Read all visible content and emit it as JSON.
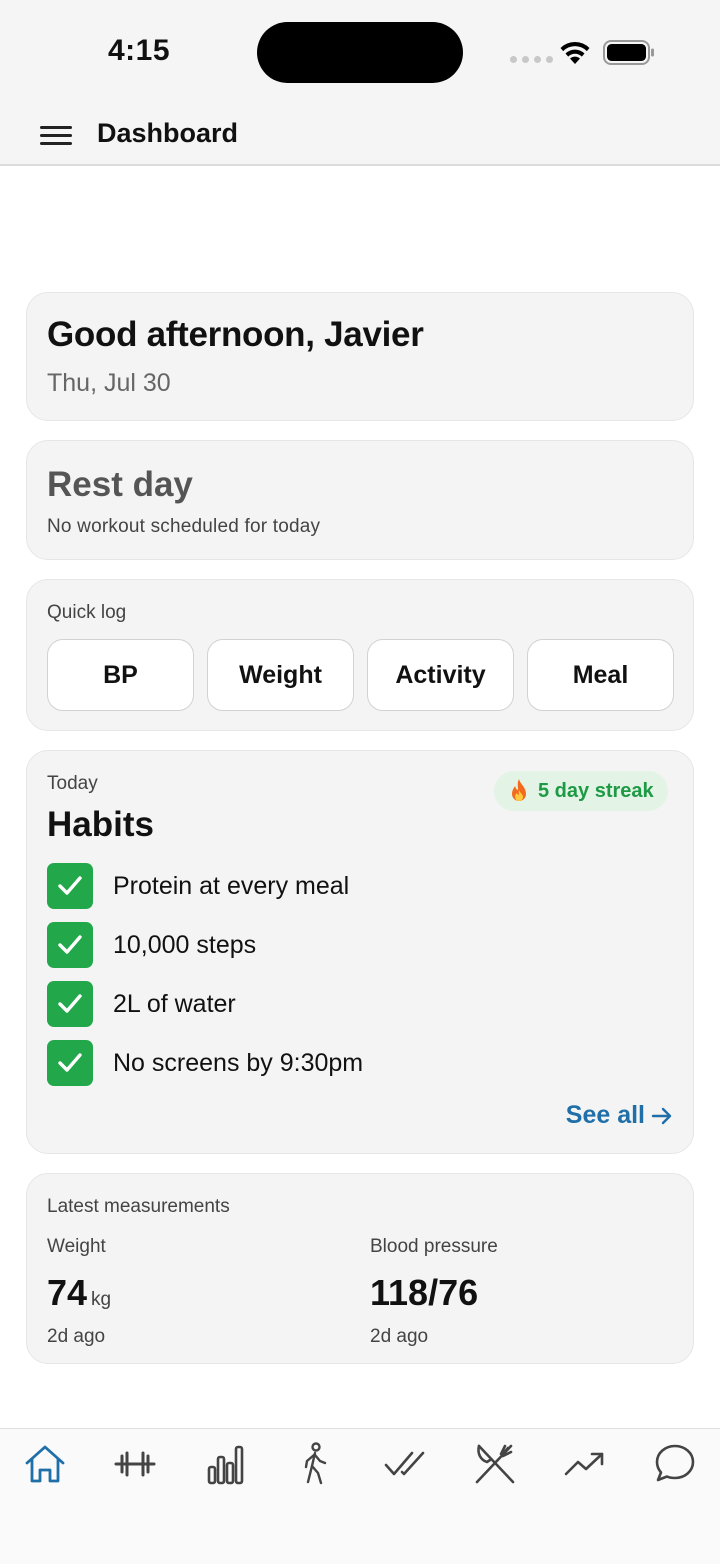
{
  "status_bar": {
    "time": "4:15"
  },
  "header": {
    "title": "Dashboard"
  },
  "greeting": {
    "title": "Good afternoon, Javier",
    "date": "Thu, Jul 30"
  },
  "workout": {
    "title": "Rest day",
    "subtitle": "No workout scheduled for today"
  },
  "quick_log": {
    "label": "Quick log",
    "buttons": [
      {
        "label": "BP"
      },
      {
        "label": "Weight"
      },
      {
        "label": "Activity"
      },
      {
        "label": "Meal"
      }
    ]
  },
  "habits": {
    "eyebrow": "Today",
    "title": "Habits",
    "streak": "5 day streak",
    "items": [
      {
        "label": "Protein at every meal",
        "done": true
      },
      {
        "label": "10,000 steps",
        "done": true
      },
      {
        "label": "2L of water",
        "done": true
      },
      {
        "label": "No screens by 9:30pm",
        "done": true
      }
    ],
    "see_all": "See all"
  },
  "measurements": {
    "label": "Latest measurements",
    "weight": {
      "name": "Weight",
      "value": "74",
      "unit": "kg",
      "ago": "2d ago"
    },
    "blood_pressure": {
      "name": "Blood pressure",
      "value": "118/76",
      "ago": "2d ago"
    }
  },
  "tab_bar": {
    "active_color": "#1f6fa8",
    "inactive_color": "#555555",
    "tabs": [
      {
        "icon": "home-icon",
        "active": true
      },
      {
        "icon": "dumbbell-icon",
        "active": false
      },
      {
        "icon": "bar-chart-icon",
        "active": false
      },
      {
        "icon": "walking-icon",
        "active": false
      },
      {
        "icon": "double-check-icon",
        "active": false
      },
      {
        "icon": "fork-knife-icon",
        "active": false
      },
      {
        "icon": "trend-up-icon",
        "active": false
      },
      {
        "icon": "chat-bubble-icon",
        "active": false
      }
    ]
  },
  "colors": {
    "accent": "#1f6fa8",
    "success": "#22a84a",
    "streak_bg": "#e3f4e6",
    "streak_text": "#1e9a45"
  }
}
